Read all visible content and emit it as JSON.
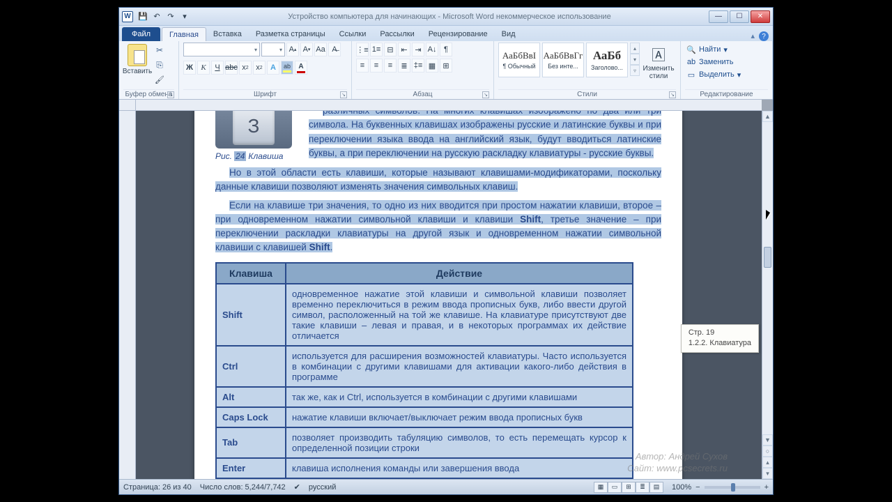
{
  "window": {
    "title": "Устройство компьютера для начинающих - Microsoft Word некоммерческое использование"
  },
  "qat": {
    "word": "W"
  },
  "tabs": {
    "file": "Файл",
    "items": [
      "Главная",
      "Вставка",
      "Разметка страницы",
      "Ссылки",
      "Рассылки",
      "Рецензирование",
      "Вид"
    ]
  },
  "ribbon": {
    "clipboard": {
      "paste": "Вставить",
      "label": "Буфер обмена"
    },
    "font": {
      "label": "Шрифт",
      "grow": "A",
      "shrink": "A",
      "case": "Aa",
      "clear": "⌫",
      "bold": "Ж",
      "italic": "К",
      "underline": "Ч",
      "strike": "abc",
      "sub": "x₂",
      "sup": "x²",
      "effects": "A",
      "highlight": "A",
      "color": "A"
    },
    "paragraph": {
      "label": "Абзац"
    },
    "styles": {
      "label": "Стили",
      "change": "Изменить стили",
      "items": [
        {
          "sample": "АаБбВвІ",
          "name": "¶ Обычный"
        },
        {
          "sample": "АаБбВвГг",
          "name": "Без инте..."
        },
        {
          "sample": "АаБб",
          "name": "Заголово..."
        }
      ]
    },
    "editing": {
      "label": "Редактирование",
      "find": "Найти",
      "replace": "Заменить",
      "select": "Выделить"
    }
  },
  "document": {
    "keycap": "З",
    "caption_prefix": "Рис.",
    "caption_num": "24",
    "caption_text": "Клавиша",
    "p1": "различных символов. На многих клавишах изображено по два или три символа. На буквенных клавишах изображены русские и латинские буквы и при переключении языка ввода на английский язык, будут вводиться латинские буквы, а при переключении на русскую раскладку клавиатуры - русские буквы.",
    "p2a": "Но в этой области есть клавиши, которые называют клавишами-модификаторами, поскольку данные клавиши позволяют изменять значения символьных клавиш.",
    "p3a": "Если на клавише три значения, то одно из них вводится при простом нажатии клавиши, второе – при одновременном нажатии символьной клавиши и клавиши ",
    "p3b": ", третье значение – при переключении раскладки клавиатуры на другой язык и одновременном нажатии символьной клавиши с клавишей ",
    "shift": "Shift",
    "table": {
      "h1": "Клавиша",
      "h2": "Действие",
      "rows": [
        {
          "k": "Shift",
          "d": "одновременное нажатие этой клавиши и символьной клавиши позволяет временно переключиться в режим ввода прописных букв, либо ввести другой символ, расположенный на той же клавише. На клавиатуре присутствуют две такие клавиши – левая и правая, и в некоторых программах их действие отличается"
        },
        {
          "k": "Ctrl",
          "d": "используется для расширения возможностей клавиатуры. Часто используется в комбинации с другими клавишами для активации какого-либо действия в программе"
        },
        {
          "k": "Alt",
          "d": "так же, как и Ctrl, используется в комбинации с другими клавишами"
        },
        {
          "k": "Caps Lock",
          "d": "нажатие клавиши включает/выключает режим ввода прописных букв"
        },
        {
          "k": "Tab",
          "d": "позволяет производить табуляцию символов, то есть перемещать курсор к определенной позиции строки"
        },
        {
          "k": "Enter",
          "d": "клавиша исполнения команды или завершения ввода"
        }
      ]
    }
  },
  "tooltip": {
    "line1": "Стр. 19",
    "line2": "1.2.2. Клавиатура"
  },
  "status": {
    "page": "Страница: 26 из 40",
    "words": "Число слов: 5,244/7,742",
    "lang": "русский",
    "zoom": "100%"
  },
  "watermark": {
    "line1": "Автор: Андрей Сухов",
    "line2": "Сайт: www.pcsecrets.ru"
  }
}
